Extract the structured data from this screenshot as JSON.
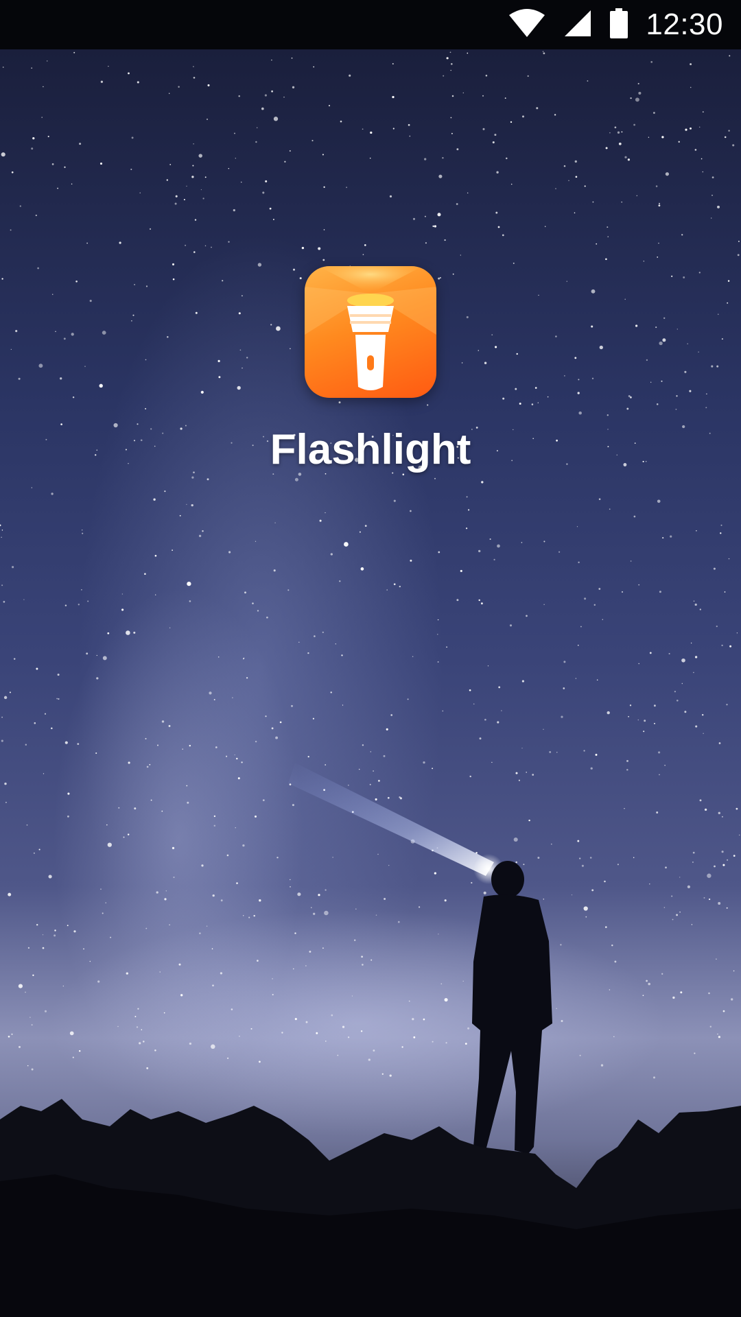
{
  "status_bar": {
    "time": "12:30",
    "icons": [
      "wifi-icon",
      "cellular-signal-icon",
      "battery-icon"
    ]
  },
  "launcher": {
    "app_name": "Flashlight",
    "icon": "flashlight-icon",
    "icon_colors": [
      "#ffb347",
      "#ff5a12"
    ]
  },
  "background": {
    "description_colors": [
      "#1a1f3c",
      "#4f5789",
      "#8c91b7"
    ]
  }
}
